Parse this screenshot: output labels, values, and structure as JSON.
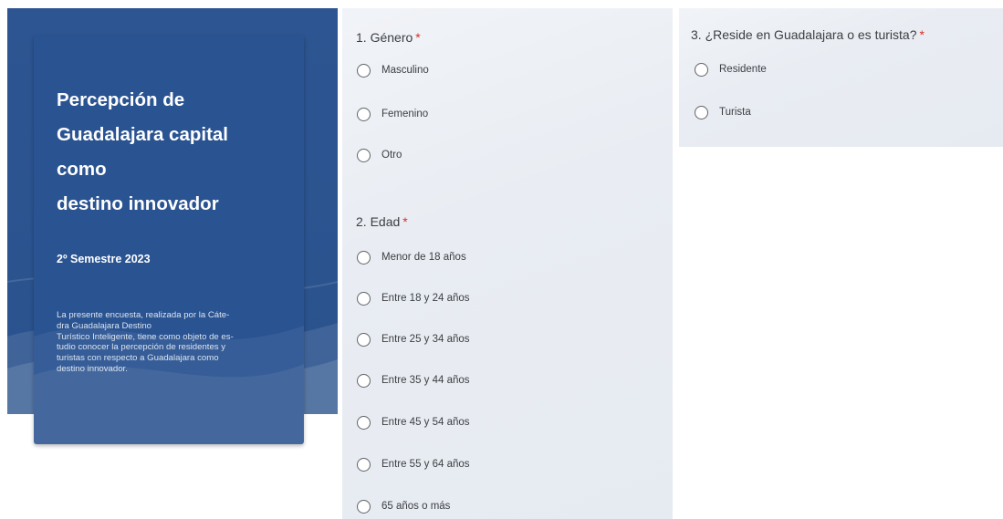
{
  "header": {
    "title_lines": [
      "Percepción de",
      "Guadalajara capital",
      "como",
      "destino innovador"
    ],
    "subtitle": "2º Semestre 2023",
    "description": "La presente encuesta, realizada por la Cáte-\ndra Guadalajara Destino\nTurístico Inteligente, tiene como objeto de es-\ntudio conocer la percepción de residentes y\nturistas con respecto a Guadalajara como\ndestino innovador."
  },
  "questions": [
    {
      "label": "1. Género",
      "required_mark": "*",
      "options": [
        "Masculino",
        "Femenino",
        "Otro"
      ]
    },
    {
      "label": "2. Edad",
      "required_mark": "*",
      "options": [
        "Menor de 18 años",
        "Entre 18 y 24 años",
        "Entre 25 y 34 años",
        "Entre 35 y 44 años",
        "Entre 45 y 54 años",
        "Entre 55 y 64 años",
        "65 años o más"
      ]
    },
    {
      "label": "3. ¿Reside en Guadalajara o es turista?",
      "required_mark": "*",
      "options": [
        "Residente",
        "Turista"
      ]
    }
  ],
  "colors": {
    "hero_background": "#2a5391",
    "panel_background": "#e9edf3",
    "required_mark": "#d93025"
  }
}
